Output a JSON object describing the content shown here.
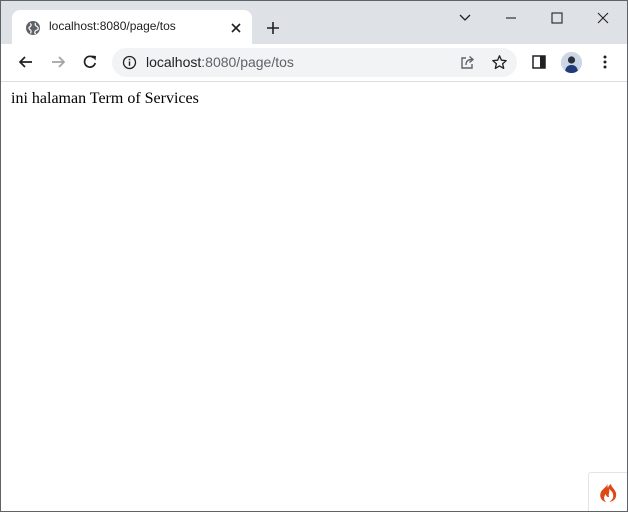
{
  "browser": {
    "tab": {
      "title": "localhost:8080/page/tos"
    },
    "address_bar": {
      "host": "localhost",
      "rest": ":8080/page/tos"
    }
  },
  "page": {
    "body_text": "ini halaman Term of Services"
  },
  "colors": {
    "tabstrip": "#dee1e6",
    "toolbar": "#ffffff",
    "omnibox": "#f1f3f4",
    "icon": "#5f6368",
    "ci_flame": "#dd4814"
  },
  "icons": {
    "tab_favicon": "globe-icon",
    "tab_close": "close-icon",
    "new_tab": "plus-icon",
    "tab_search": "chevron-down-icon",
    "minimize": "minimize-icon",
    "maximize": "maximize-icon",
    "close_window": "close-icon",
    "back": "arrow-left-icon",
    "forward": "arrow-right-icon",
    "reload": "reload-icon",
    "site_info": "info-icon",
    "share": "share-icon",
    "bookmark": "star-icon",
    "side_panel": "side-panel-icon",
    "profile": "avatar",
    "menu": "kebab-menu-icon",
    "debug_toolbar": "codeigniter-flame-icon"
  }
}
